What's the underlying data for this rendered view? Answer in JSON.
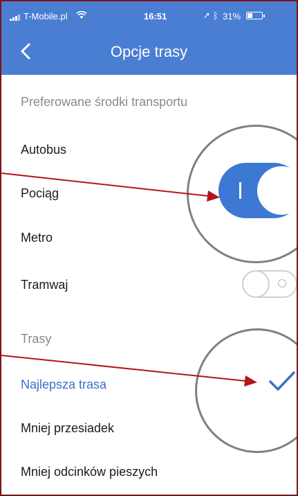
{
  "status_bar": {
    "carrier": "T-Mobile.pl",
    "time": "16:51",
    "battery": "31%"
  },
  "nav": {
    "title": "Opcje trasy",
    "back_icon": "chevron-left-icon"
  },
  "transport_section": {
    "header": "Preferowane środki transportu",
    "items": [
      {
        "label": "Autobus"
      },
      {
        "label": "Pociąg",
        "toggle": "on"
      },
      {
        "label": "Metro"
      },
      {
        "label": "Tramwaj",
        "toggle": "off"
      }
    ]
  },
  "routes_section": {
    "header": "Trasy",
    "items": [
      {
        "label": "Najlepsza trasa",
        "selected": true
      },
      {
        "label": "Mniej przesiadek"
      },
      {
        "label": "Mniej odcinków pieszych"
      }
    ]
  },
  "colors": {
    "header_bg": "#4a7ed3",
    "accent": "#3c6fc7",
    "annotation_arrow": "#b5141c"
  }
}
